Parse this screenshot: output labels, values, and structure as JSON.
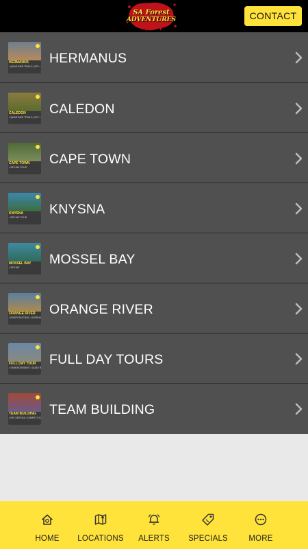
{
  "header": {
    "logo_line1": "SA Forest",
    "logo_line2": "ADVENTURES",
    "contact_label": "CONTACT"
  },
  "locations": [
    {
      "label": "HERMANUS",
      "thumb_title": "HERMANUS",
      "thumb_sub": "• QUAD BIKE TRAILS | ATV  • SANDBOARDING",
      "photo_top": "#6f7f8f",
      "photo_bottom": "#b88a5a"
    },
    {
      "label": "CALEDON",
      "thumb_title": "CALEDON",
      "thumb_sub": "• QUAD BIKE TRAILS | ATV  • ZIPLINE TOUR",
      "photo_top": "#8a7b3f",
      "photo_bottom": "#5a6b2f"
    },
    {
      "label": "CAPE TOWN",
      "thumb_title": "CAPE TOWN",
      "thumb_sub": "• ZIPLINE TOUR",
      "photo_top": "#4f6a3a",
      "photo_bottom": "#7d8f5a"
    },
    {
      "label": "KNYSNA",
      "thumb_title": "KNYSNA",
      "thumb_sub": "• ZIPLINE TOUR",
      "photo_top": "#3a88b0",
      "photo_bottom": "#3d6b3a"
    },
    {
      "label": "MOSSEL BAY",
      "thumb_title": "MOSSEL BAY",
      "thumb_sub": "• ZIPLINE",
      "photo_top": "#3f8aa0",
      "photo_bottom": "#2f6a5a"
    },
    {
      "label": "ORANGE RIVER",
      "thumb_title": "ORANGE RIVER",
      "thumb_sub": "• RIVER RAFTING  • OVERNIGHT ADVENTURE",
      "photo_top": "#5a7fa0",
      "photo_bottom": "#b08a4a"
    },
    {
      "label": "FULL DAY TOURS",
      "thumb_title": "FULL DAY TOUR",
      "thumb_sub": "• SANDBOARDING  • QUAD BIKE TRAILS | ATV",
      "photo_top": "#6a88a8",
      "photo_bottom": "#8a8a7a"
    },
    {
      "label": "TEAM BUILDING",
      "thumb_title": "TEAM BUILDING",
      "thumb_sub": "• PAT SERVICE COMPETITION  • WHAT'S TO HENRY",
      "photo_top": "#a04a3a",
      "photo_bottom": "#6a5a8a"
    }
  ],
  "bottom_nav": [
    {
      "label": "HOME",
      "icon": "home-icon"
    },
    {
      "label": "LOCATIONS",
      "icon": "map-pin-icon"
    },
    {
      "label": "ALERTS",
      "icon": "bell-icon"
    },
    {
      "label": "SPECIALS",
      "icon": "tag-icon"
    },
    {
      "label": "MORE",
      "icon": "more-dots-icon"
    }
  ],
  "colors": {
    "accent": "#ffe23a",
    "row_bg": "#505050",
    "header_bg": "#000000",
    "logo_splat": "#c0121a"
  }
}
